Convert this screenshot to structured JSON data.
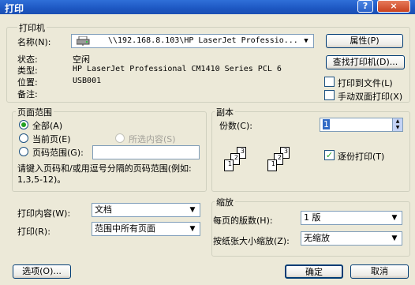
{
  "window": {
    "title": "打印",
    "help_label": "?",
    "close_label": "×"
  },
  "printer": {
    "legend": "打印机",
    "name_label": "名称(N):",
    "name_value": "\\\\192.168.8.103\\HP LaserJet Professio...",
    "properties_button": "属性(P)",
    "status_label": "状态:",
    "status_value": "空闲",
    "type_label": "类型:",
    "type_value": "HP LaserJet Professional CM1410 Series PCL 6",
    "location_label": "位置:",
    "location_value": "USB001",
    "comment_label": "备注:",
    "comment_value": "",
    "find_button": "查找打印机(D)...",
    "print_to_file_label": "打印到文件(L)",
    "manual_duplex_label": "手动双面打印(X)"
  },
  "page_range": {
    "legend": "页面范围",
    "all_label": "全部(A)",
    "current_label": "当前页(E)",
    "selection_label": "所选内容(S)",
    "pages_label": "页码范围(G):",
    "pages_value": "",
    "hint": "请键入页码和/或用逗号分隔的页码范围(例如: 1,3,5-12)。",
    "selected": "all"
  },
  "copies": {
    "legend": "副本",
    "count_label": "份数(C):",
    "count_value": "1",
    "collate_label": "逐份打印(T)",
    "collate_checked": true
  },
  "print_content": {
    "what_label": "打印内容(W):",
    "what_value": "文档",
    "print_label": "打印(R):",
    "print_value": "范围中所有页面"
  },
  "zoom": {
    "legend": "缩放",
    "pages_per_sheet_label": "每页的版数(H):",
    "pages_per_sheet_value": "1 版",
    "scale_label": "按纸张大小缩放(Z):",
    "scale_value": "无缩放"
  },
  "footer": {
    "options_button": "选项(O)...",
    "ok_button": "确定",
    "cancel_button": "取消"
  },
  "icons": {
    "printer": "printer-icon",
    "dropdown": "chevron-down-icon"
  }
}
